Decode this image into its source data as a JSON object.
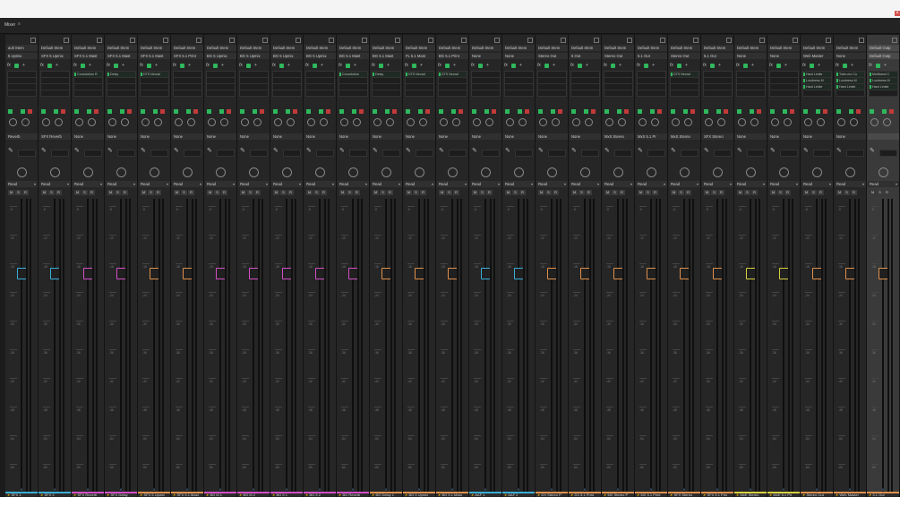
{
  "window": {
    "close_label": "×"
  },
  "panel": {
    "title": "Mixer",
    "menu": "≡"
  },
  "channels": [
    {
      "bus": "ault Stem",
      "output": "5 Upmix",
      "send": "Reverb",
      "name": "SFX 1",
      "color": "#3aaed8",
      "inserts": []
    },
    {
      "bus": "Default Stem",
      "output": "SFX 5 Upmix",
      "send": "SFX Reverb",
      "name": "SFX 2",
      "color": "#3aaed8",
      "inserts": []
    },
    {
      "bus": "Default Stem",
      "output": "SFX 5.1 Mast",
      "send": "None",
      "name": "SFX Reverb",
      "color": "#d44fc8",
      "inserts": [
        "Convolution R"
      ]
    },
    {
      "bus": "Default Stem",
      "output": "SFX 5.1 Mast",
      "send": "None",
      "name": "SFX Delay",
      "color": "#d44fc8",
      "inserts": [
        "Delay"
      ]
    },
    {
      "bus": "Default Stem",
      "output": "SFX 5.1 Mast",
      "send": "None",
      "name": "SFX 5 Upmix",
      "color": "#e0904c",
      "inserts": [
        "DTS Neural"
      ]
    },
    {
      "bus": "Default Stem",
      "output": "SFX 5.1 Print",
      "send": "None",
      "name": "SFX 5.1 Mast",
      "color": "#e0904c",
      "inserts": []
    },
    {
      "bus": "Default Stem",
      "output": "BG 5 Upmix",
      "send": "None",
      "name": "BG M 1",
      "color": "#d44fc8",
      "inserts": []
    },
    {
      "bus": "Default Stem",
      "output": "BG 5 Upmix",
      "send": "None",
      "name": "BG M 2",
      "color": "#d44fc8",
      "inserts": []
    },
    {
      "bus": "Default Stem",
      "output": "BG 5 Upmix",
      "send": "None",
      "name": "BG 5 1",
      "color": "#d44fc8",
      "inserts": []
    },
    {
      "bus": "Default Stem",
      "output": "BG 5 Upmix",
      "send": "None",
      "name": "BG 5 2",
      "color": "#d44fc8",
      "inserts": []
    },
    {
      "bus": "Default Stem",
      "output": "BG 5.1 Mast",
      "send": "None",
      "name": "BG Reverb",
      "color": "#d44fc8",
      "inserts": [
        "Convolution"
      ]
    },
    {
      "bus": "Default Stem",
      "output": "BG 5.1 Mast",
      "send": "None",
      "name": "BG Delay 1",
      "color": "#e0904c",
      "inserts": [
        "Delay"
      ]
    },
    {
      "bus": "Default Stem",
      "output": "FL 5.1 Mast",
      "send": "None",
      "name": "BG 5 Upmix",
      "color": "#e0904c",
      "inserts": [
        "DTS Neural"
      ]
    },
    {
      "bus": "Default Stem",
      "output": "BG 5.1 Print",
      "send": "None",
      "name": "BG 5.1 Mast",
      "color": "#e0904c",
      "inserts": [
        "DTS Neural"
      ]
    },
    {
      "bus": "Default Stem",
      "output": "None",
      "send": "None",
      "name": "AAF 1",
      "color": "#3aaed8",
      "inserts": []
    },
    {
      "bus": "Default Stem",
      "output": "None",
      "send": "None",
      "name": "AAF 2",
      "color": "#3aaed8",
      "inserts": []
    },
    {
      "bus": "Default Stem",
      "output": "Stereo Out",
      "send": "None",
      "name": "DX Stereo P",
      "color": "#e0904c",
      "inserts": []
    },
    {
      "bus": "Default Stem",
      "output": "5 Out",
      "send": "None",
      "name": "DX 5.1 Print",
      "color": "#e0904c",
      "inserts": []
    },
    {
      "bus": "Default Stem",
      "output": "Stereo Out",
      "send": "MxS Stereo",
      "name": "MX Stereo P",
      "color": "#e0904c",
      "inserts": []
    },
    {
      "bus": "Default Stem",
      "output": "5.1 Out",
      "send": "MxS 5.1 Pr",
      "name": "MX 5.1 Print",
      "color": "#e0904c",
      "inserts": []
    },
    {
      "bus": "Default Stem",
      "output": "Stereo Out",
      "send": "MxS Stereo",
      "name": "SFX Stereo",
      "color": "#e0904c",
      "inserts": [
        "DTS Neural"
      ]
    },
    {
      "bus": "Default Stem",
      "output": "5.1 Out",
      "send": "SFX Stereo",
      "name": "SFX 5.1 Prin",
      "color": "#e0904c",
      "inserts": []
    },
    {
      "bus": "Default Stem",
      "output": "None",
      "send": "None",
      "name": "MxE Stereo",
      "color": "#d8d040",
      "inserts": []
    },
    {
      "bus": "Default Stem",
      "output": "None",
      "send": "None",
      "name": "MxE 5.1 Pri",
      "color": "#d8d040",
      "inserts": []
    },
    {
      "bus": "Default Stem",
      "output": "Web Master",
      "send": "None",
      "name": "Stereo Out",
      "color": "#e0904c",
      "inserts": [
        "Hard Limite",
        "Loudness M",
        "Hard Limite"
      ]
    },
    {
      "bus": "Default Stem",
      "output": "None",
      "send": "None",
      "name": "Web Master",
      "color": "#e0904c",
      "inserts": [
        "Tube-mo Co",
        "Loudness M",
        "Hard Limite"
      ]
    },
    {
      "bus": "Default Outp",
      "output": "Default Outp",
      "send": "",
      "name": "5.1 Out",
      "color": "#e0904c",
      "inserts": [
        "Multiband C",
        "Loudness M",
        "Hard Limite"
      ]
    }
  ],
  "strip_labels": {
    "automation": "Read",
    "mute": "M",
    "solo": "S",
    "rec": "R",
    "fx": "fx",
    "send_icon": "✎",
    "volume": "0"
  },
  "db_scale": [
    "-6",
    "-12",
    "-18",
    "-24",
    "-30",
    "-36",
    "-42",
    "-48",
    "-54",
    "-60"
  ]
}
